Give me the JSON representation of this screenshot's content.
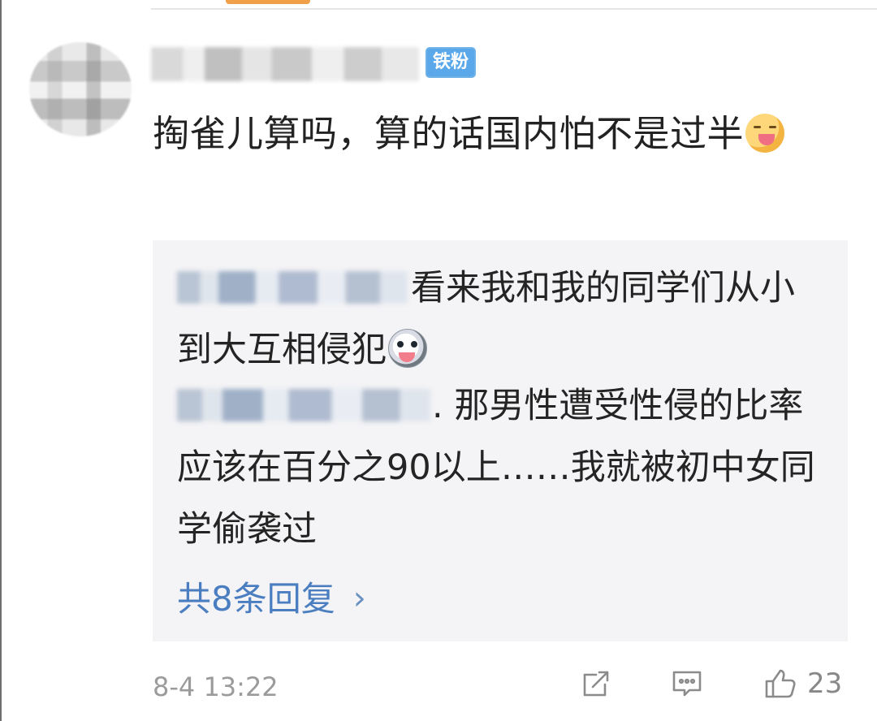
{
  "comment": {
    "badge": "铁粉",
    "content": "掏雀儿算吗，算的话国内怕不是过半",
    "emoji": "yum-face-icon",
    "timestamp": "8-4 13:22",
    "like_count": "23"
  },
  "replies": [
    {
      "text": "看来我和我的同学们从小到大互相侵犯",
      "emoji": "dog-face-icon"
    },
    {
      "text": ". 那男性遭受性侵的比率应该在百分之90以上……我就被初中女同学偷袭过"
    }
  ],
  "replies_link": {
    "label": "共8条回复",
    "arrow": "›"
  },
  "icons": {
    "share": "share-icon",
    "comment": "comment-icon",
    "like": "thumbs-up-icon"
  },
  "colors": {
    "badge": "#5aa8ea",
    "reply_link": "#4b7ec0",
    "reply_background": "#f4f4f6"
  }
}
